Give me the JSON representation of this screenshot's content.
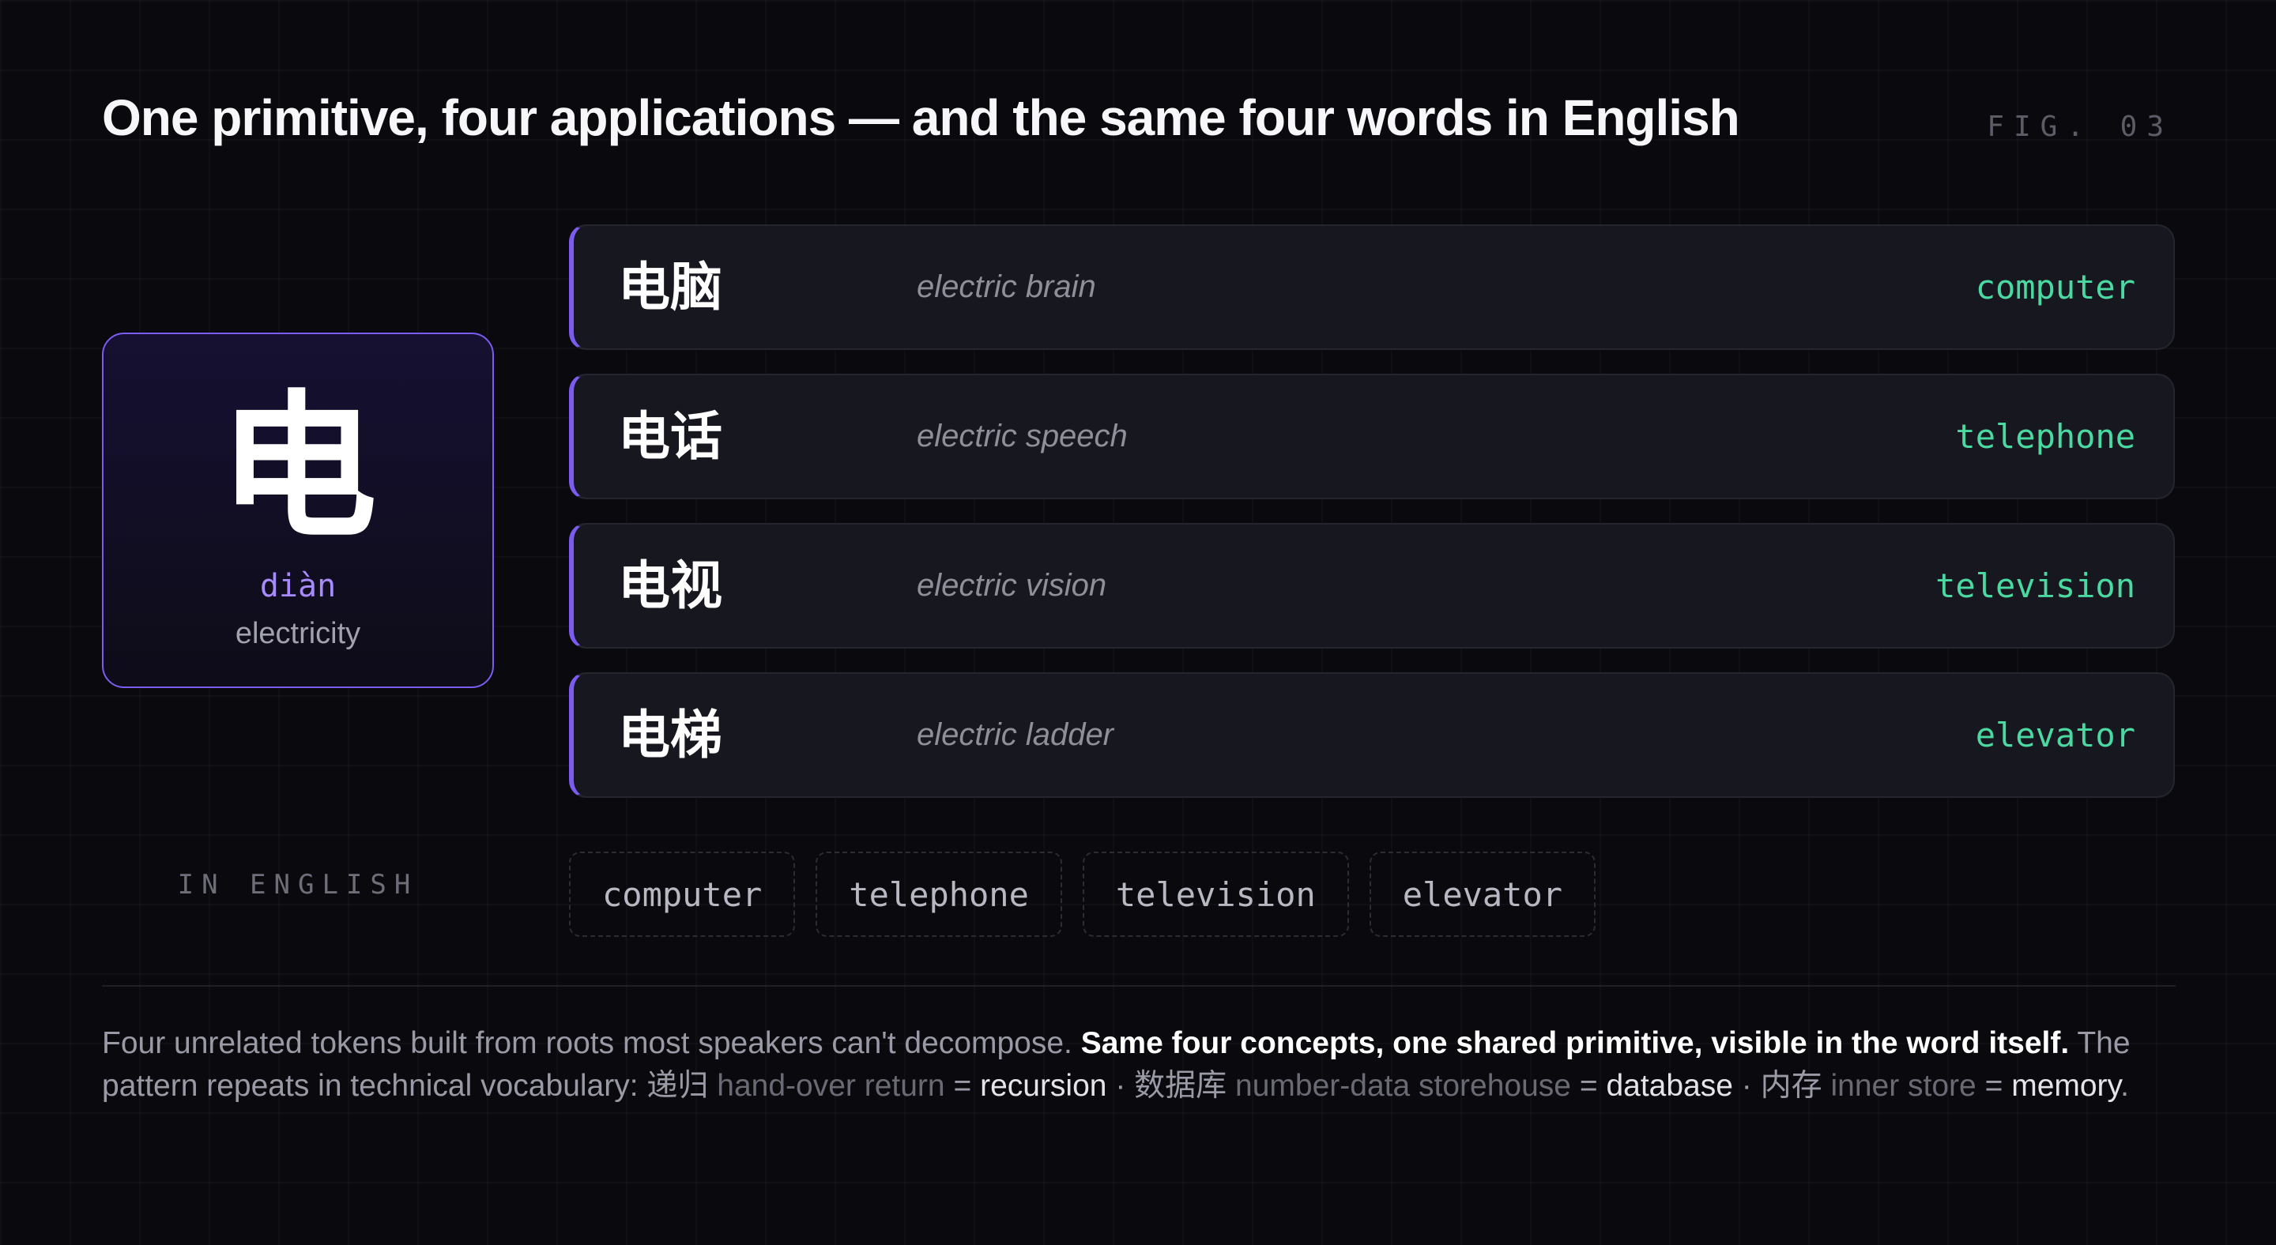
{
  "header": {
    "title": "One primitive, four applications — and the same four words in English",
    "fig_label": "FIG. 03"
  },
  "primitive": {
    "character": "电",
    "pinyin": "diàn",
    "gloss": "electricity"
  },
  "words": [
    {
      "hanzi": "电脑",
      "literal": "electric brain",
      "english": "computer"
    },
    {
      "hanzi": "电话",
      "literal": "electric speech",
      "english": "telephone"
    },
    {
      "hanzi": "电视",
      "literal": "electric vision",
      "english": "television"
    },
    {
      "hanzi": "电梯",
      "literal": "electric ladder",
      "english": "elevator"
    }
  ],
  "english_section": {
    "label": "IN ENGLISH",
    "chips": [
      "computer",
      "telephone",
      "television",
      "elevator"
    ]
  },
  "caption": {
    "intro": "Four unrelated tokens built from roots most speakers can't decompose.",
    "emphasis": "Same four concepts, one shared primitive, visible in the word itself.",
    "pattern_lead": "The pattern repeats in technical vocabulary:",
    "examples": [
      {
        "hanzi": "递归",
        "literal": "hand-over return",
        "equals": "=",
        "english": "recursion"
      },
      {
        "hanzi": "数据库",
        "literal": "number-data storehouse",
        "equals": "=",
        "english": "database"
      },
      {
        "hanzi": "内存",
        "literal": "inner store",
        "equals": "=",
        "english": "memory"
      }
    ],
    "separator": "·",
    "end": "."
  },
  "colors": {
    "background": "#0a0a0e",
    "accent_purple": "#7c5cf0",
    "pinyin_purple": "#a78bfa",
    "english_green": "#4ad9a0",
    "card": "#17171f"
  }
}
